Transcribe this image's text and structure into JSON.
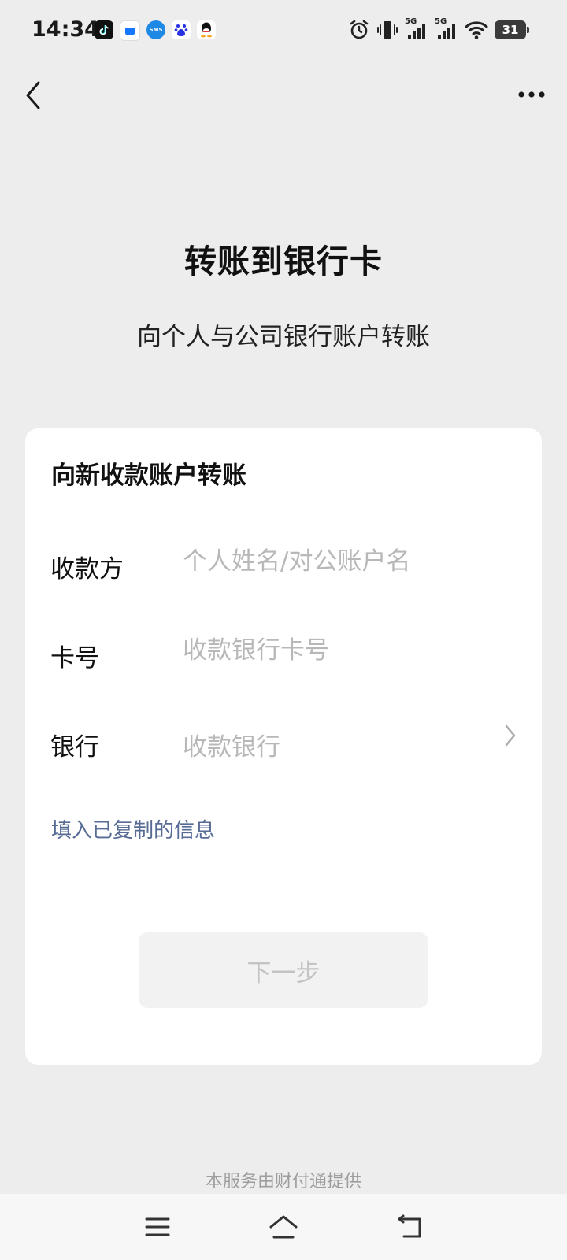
{
  "status_bar": {
    "time": "14:34",
    "notification_icons": [
      "tiktok-icon",
      "message-icon",
      "sms-icon",
      "baidu-icon",
      "qq-icon"
    ],
    "sms_label": "SMS",
    "network_label_1": "5G",
    "network_label_2": "5G",
    "battery_level": "31"
  },
  "header": {
    "back_icon": "chevron-left-icon",
    "more_icon": "more-dots-icon"
  },
  "title": "转账到银行卡",
  "subtitle": "向个人与公司银行账户转账",
  "form": {
    "section_title": "向新收款账户转账",
    "payee": {
      "label": "收款方",
      "placeholder": "个人姓名/对公账户名",
      "value": ""
    },
    "card_number": {
      "label": "卡号",
      "placeholder": "收款银行卡号",
      "value": ""
    },
    "bank": {
      "label": "银行",
      "placeholder": "收款银行"
    },
    "paste_link": "填入已复制的信息",
    "next_button": "下一步"
  },
  "footer": {
    "service_note": "本服务由财付通提供"
  },
  "colors": {
    "background": "#ededed",
    "card": "#ffffff",
    "link": "#576b95",
    "placeholder": "#b8b8b8",
    "button_disabled_bg": "#f2f2f2",
    "button_disabled_text": "#c4c4c4"
  }
}
